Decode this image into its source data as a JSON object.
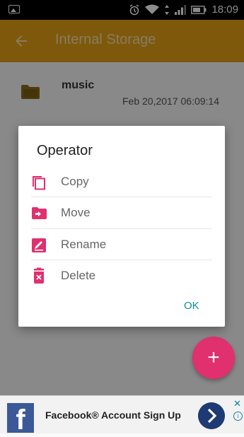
{
  "status_bar": {
    "time": "18:09",
    "icons": [
      "image-icon",
      "alarm-icon",
      "wifi-icon",
      "vibrate-icon",
      "signal-icon",
      "battery-icon"
    ]
  },
  "appbar": {
    "title": "Internal Storage",
    "back_icon": "arrow-left-icon",
    "color": "#e6a315"
  },
  "list": {
    "items": [
      {
        "name": "music",
        "date": "Feb 20,2017 06:09:14",
        "icon": "folder-icon"
      }
    ]
  },
  "dialog": {
    "title": "Operator",
    "items": [
      {
        "label": "Copy",
        "icon": "copy-icon"
      },
      {
        "label": "Move",
        "icon": "move-icon"
      },
      {
        "label": "Rename",
        "icon": "rename-icon"
      },
      {
        "label": "Delete",
        "icon": "delete-icon"
      }
    ],
    "ok_label": "OK",
    "accent": "#e0306e",
    "ok_color": "#128c8c"
  },
  "fab": {
    "icon": "plus-icon",
    "label": "+"
  },
  "ad": {
    "text": "Facebook® Account Sign Up",
    "logo_letter": "f",
    "arrow_icon": "chevron-right-icon",
    "close_label": "✕",
    "info_label": "i"
  }
}
